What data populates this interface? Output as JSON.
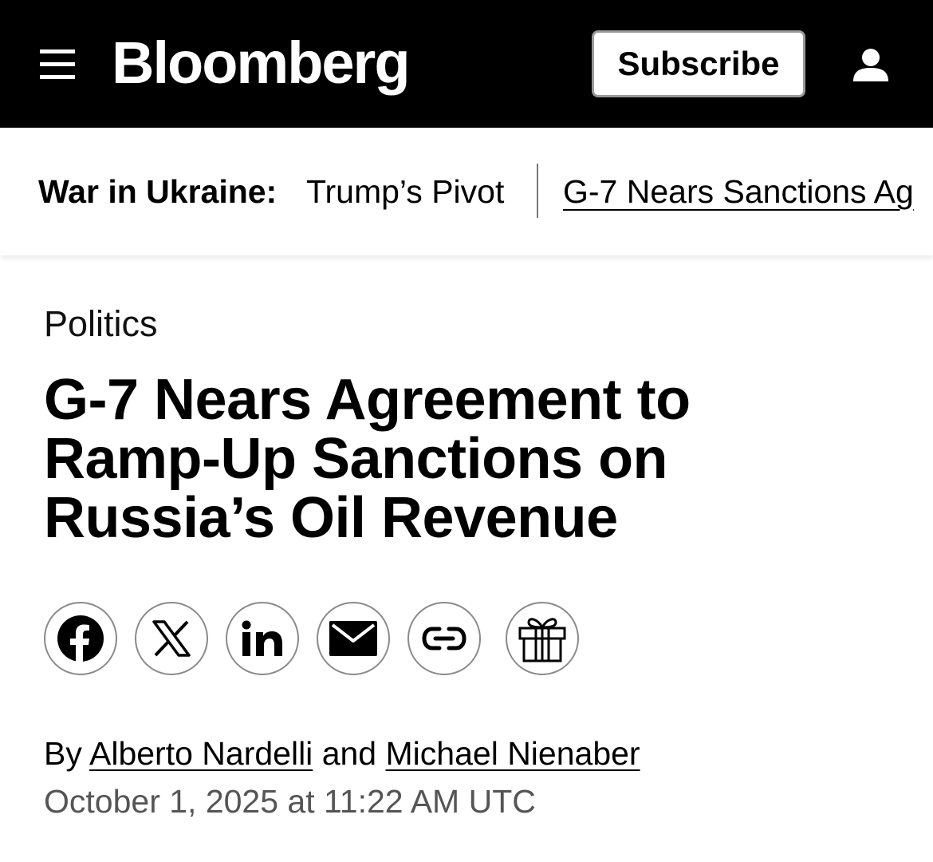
{
  "header": {
    "brand": "Bloomberg",
    "subscribe_label": "Subscribe",
    "menu_icon": "hamburger-menu-icon",
    "account_icon": "user-account-icon",
    "background_color": "#000000"
  },
  "topic_bar": {
    "label": "War in Ukraine:",
    "links": [
      "Trump’s Pivot",
      "G-7 Nears Sanctions Ag"
    ]
  },
  "article": {
    "section": "Politics",
    "headline": "G-7 Nears Agreement to Ramp-Up Sanctions on Russia’s Oil Revenue",
    "share_icons": [
      "facebook-icon",
      "x-icon",
      "linkedin-icon",
      "email-icon",
      "link-icon",
      "gift-icon"
    ],
    "byline_prefix": "By",
    "authors": [
      "Alberto Nardelli",
      "Michael Nienaber"
    ],
    "byline_joiner": "and",
    "timestamp": "October 1, 2025 at 11:22 AM UTC"
  }
}
